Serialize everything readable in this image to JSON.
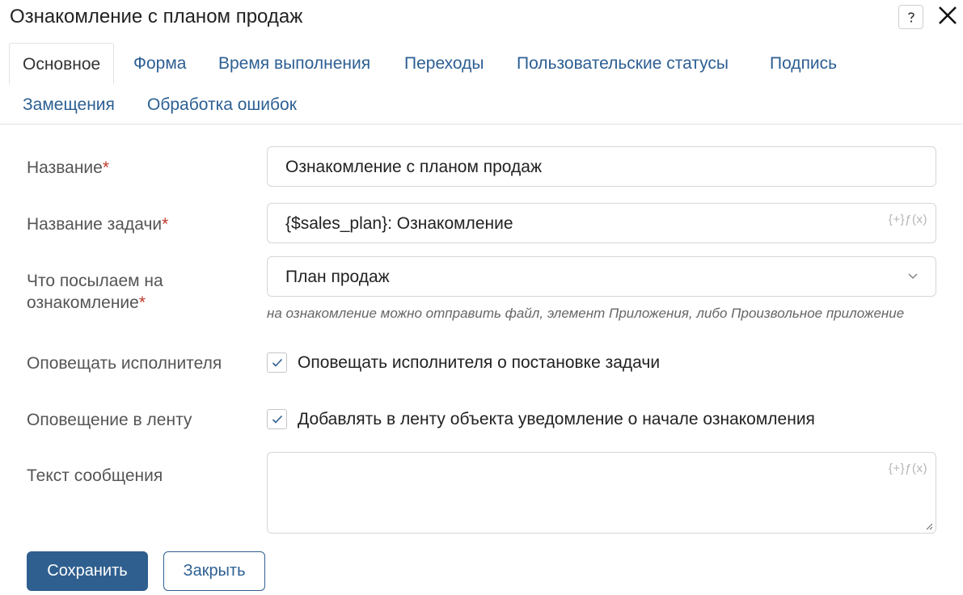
{
  "dialog": {
    "title": "Ознакомление с планом продаж",
    "help_icon": "question-icon",
    "close_icon": "close-icon"
  },
  "tabs": [
    {
      "label": "Основное",
      "active": true
    },
    {
      "label": "Форма",
      "active": false
    },
    {
      "label": "Время выполнения",
      "active": false
    },
    {
      "label": "Переходы",
      "active": false
    },
    {
      "label": "Пользовательские статусы",
      "active": false
    },
    {
      "label": "Подпись",
      "active": false
    },
    {
      "label": "Замещения",
      "active": false
    },
    {
      "label": "Обработка ошибок",
      "active": false
    }
  ],
  "form": {
    "name": {
      "label": "Название",
      "required_mark": "*",
      "value": "Ознакомление с планом продаж"
    },
    "task_name": {
      "label": "Название задачи",
      "required_mark": "*",
      "value": "{$sales_plan}: Ознакомление",
      "fx_label": "{+}ƒ(x)"
    },
    "send": {
      "label_line1": "Что посылаем на",
      "label_line2": "ознакомление",
      "required_mark": "*",
      "value": "План продаж",
      "hint": "на ознакомление можно отправить файл, элемент Приложения, либо Произвольное приложение"
    },
    "notify_executor": {
      "label": "Оповещать исполнителя",
      "checked": true,
      "checkbox_label": "Оповещать исполнителя о постановке задачи"
    },
    "notify_feed": {
      "label": "Оповещение в ленту",
      "checked": true,
      "checkbox_label": "Добавлять в ленту объекта уведомление о начале ознакомления"
    },
    "message": {
      "label": "Текст сообщения",
      "value": "",
      "fx_label": "{+}ƒ(x)"
    }
  },
  "buttons": {
    "save": "Сохранить",
    "close": "Закрыть"
  },
  "colors": {
    "accent": "#2f5f8f",
    "link": "#2d5f93",
    "required": "#c0392b"
  }
}
